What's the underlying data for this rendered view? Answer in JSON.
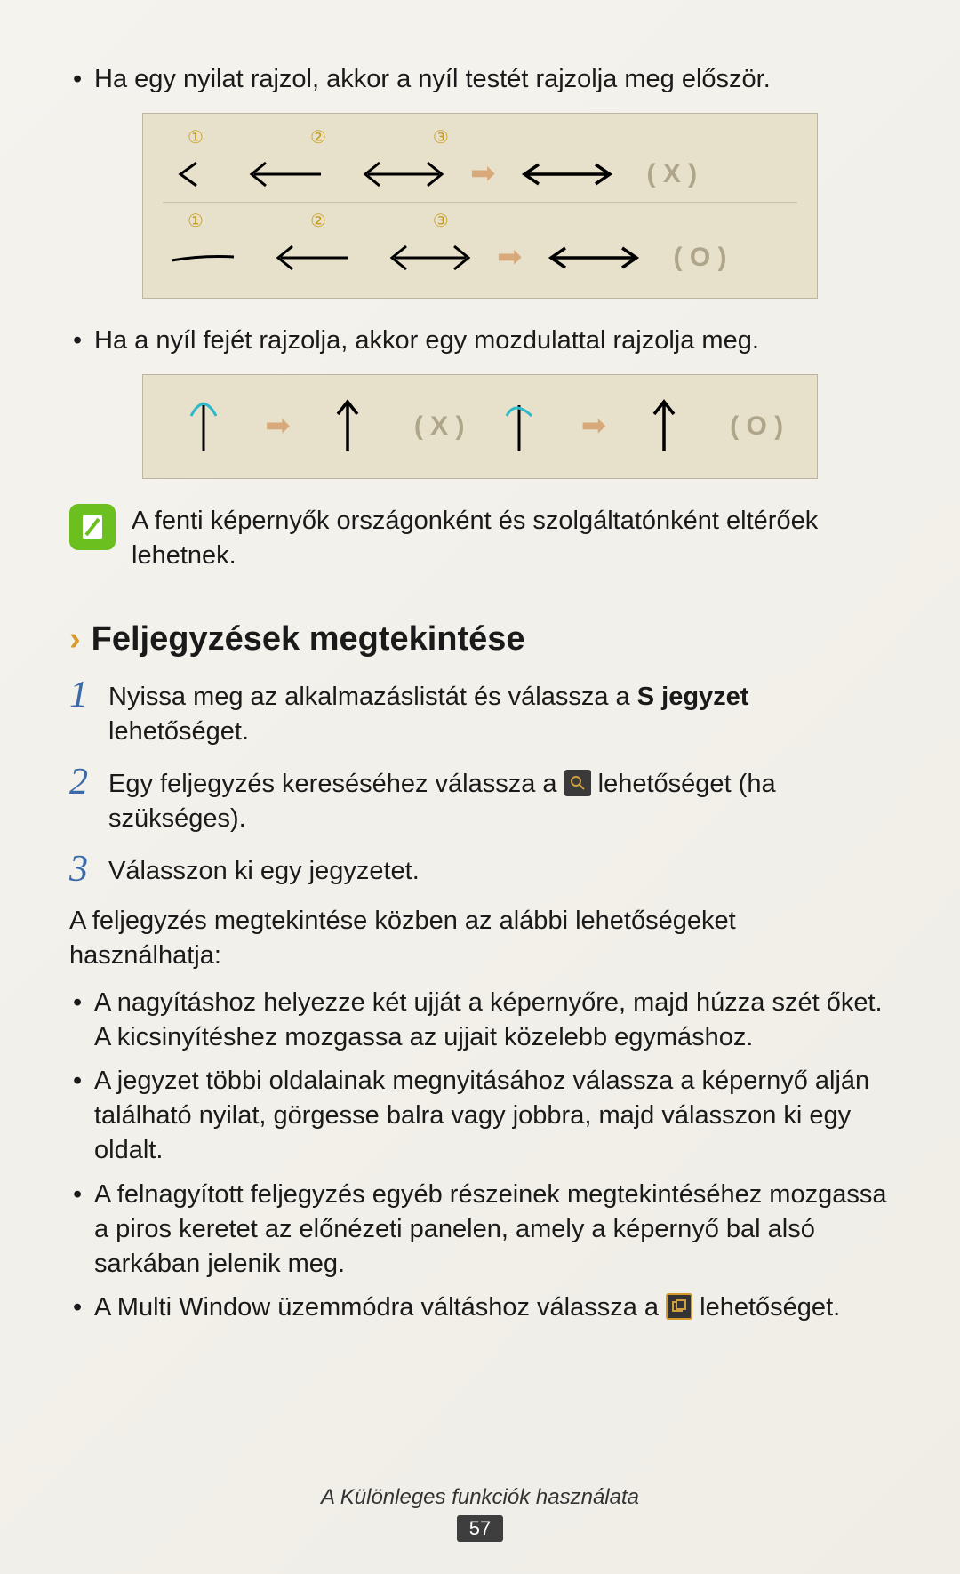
{
  "bullets_top": [
    "Ha egy nyilat rajzol, akkor a nyíl testét rajzolja meg először.",
    "Ha a nyíl fejét rajzolja, akkor egy mozdulattal rajzolja meg."
  ],
  "illus1": {
    "step_labels": [
      "①",
      "②",
      "③"
    ],
    "result_wrong": "( X )",
    "result_right": "( O )"
  },
  "illus2": {
    "result_wrong": "( X )",
    "result_right": "( O )"
  },
  "note_text": "A fenti képernyők országonként és szolgáltatónként eltérőek lehetnek.",
  "section": {
    "chevron": "›",
    "title": "Feljegyzések megtekintése"
  },
  "steps": [
    {
      "num": "1",
      "pre": "Nyissa meg az alkalmazáslistát és válassza a ",
      "bold": "S jegyzet",
      "post": " lehetőséget."
    },
    {
      "num": "2",
      "pre": "Egy feljegyzés kereséséhez válassza a ",
      "post": " lehetőséget (ha szükséges)."
    },
    {
      "num": "3",
      "pre": "Válasszon ki egy jegyzetet."
    }
  ],
  "paragraph": "A feljegyzés megtekintése közben az alábbi lehetőségeket használhatja:",
  "sub_bullets": [
    "A nagyításhoz helyezze két ujját a képernyőre, majd húzza szét őket. A kicsinyítéshez mozgassa az ujjait közelebb egymáshoz.",
    "A jegyzet többi oldalainak megnyitásához válassza a képernyő alján található nyilat, görgesse balra vagy jobbra, majd válasszon ki egy oldalt.",
    "A felnagyított feljegyzés egyéb részeinek megtekintéséhez mozgassa a piros keretet az előnézeti panelen, amely a képernyő bal alsó sarkában jelenik meg."
  ],
  "sub_bullet_icon": {
    "pre": "A Multi Window üzemmódra váltáshoz válassza a ",
    "post": " lehetőséget."
  },
  "footer": {
    "title": "A Különleges funkciók használata",
    "page": "57"
  }
}
